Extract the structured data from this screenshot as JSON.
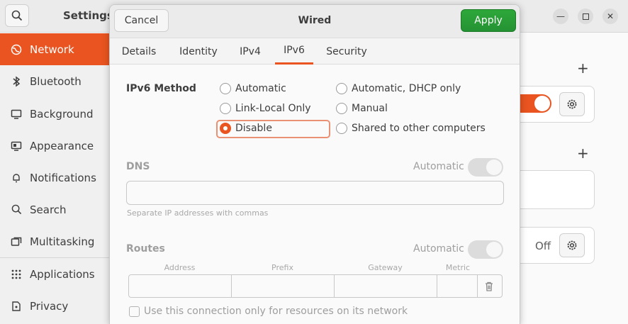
{
  "settings": {
    "title": "Settings",
    "sidebar": [
      {
        "label": "Network",
        "icon": "network-icon",
        "active": true
      },
      {
        "label": "Bluetooth",
        "icon": "bluetooth-icon"
      },
      {
        "label": "Background",
        "icon": "background-icon"
      },
      {
        "label": "Appearance",
        "icon": "appearance-icon"
      },
      {
        "label": "Notifications",
        "icon": "bell-icon"
      },
      {
        "label": "Search",
        "icon": "search-icon"
      },
      {
        "label": "Multitasking",
        "icon": "multitasking-icon"
      },
      {
        "label": "Applications",
        "icon": "applications-icon"
      },
      {
        "label": "Privacy",
        "icon": "privacy-icon"
      }
    ],
    "vpn_state": "Off"
  },
  "dialog": {
    "title": "Wired",
    "cancel_label": "Cancel",
    "apply_label": "Apply",
    "tabs": [
      {
        "label": "Details"
      },
      {
        "label": "Identity"
      },
      {
        "label": "IPv4"
      },
      {
        "label": "IPv6",
        "active": true
      },
      {
        "label": "Security"
      }
    ],
    "ipv6_method": {
      "label": "IPv6 Method",
      "options": [
        {
          "label": "Automatic",
          "checked": false
        },
        {
          "label": "Automatic, DHCP only",
          "checked": false
        },
        {
          "label": "Link-Local Only",
          "checked": false
        },
        {
          "label": "Manual",
          "checked": false
        },
        {
          "label": "Disable",
          "checked": true
        },
        {
          "label": "Shared to other computers",
          "checked": false
        }
      ]
    },
    "dns": {
      "label": "DNS",
      "auto_label": "Automatic",
      "value": "",
      "hint": "Separate IP addresses with commas"
    },
    "routes": {
      "label": "Routes",
      "auto_label": "Automatic",
      "columns": [
        "Address",
        "Prefix",
        "Gateway",
        "Metric"
      ]
    },
    "only_local_label": "Use this connection only for resources on its network"
  },
  "colors": {
    "accent": "#e95420",
    "apply": "#2ea83a"
  }
}
